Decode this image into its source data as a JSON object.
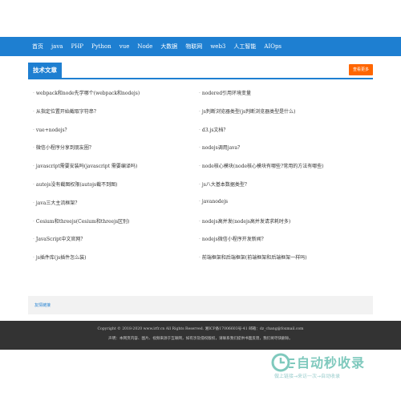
{
  "nav": {
    "items": [
      "首页",
      "java",
      "PHP",
      "Python",
      "vue",
      "Node",
      "大数据",
      "物联网",
      "web3",
      "人工智能",
      "AIOps"
    ]
  },
  "section": {
    "title": "技术文章",
    "more": "查看更多"
  },
  "articles": {
    "left": [
      "webpack和node先学哪个(webpack和nodejs)",
      "从指定位置开始截取字符串？",
      "vue+nodejs？",
      "微信小程序分享到朋友圈？",
      "javascript需要安装吗(javascript 需要编译吗)",
      "autojs没有截图权限(autojs截不到图)",
      "java三大主流框架？",
      "Cesium和threejs(Cesium和threejs区别)",
      "JavaScript中文官网？",
      "js插件库(js插件怎么装)"
    ],
    "right": [
      "nodered引用环境变量",
      "js判断浏览器类型(js判断浏览器类型是什么)",
      "d3.js文档？",
      "nodejs调用java？",
      "node核心模块(node核心模块有哪些?常用的方法有哪些)",
      "js八大基本数据类型？",
      "javanodejs",
      "nodejs高并发(nodejs高并发请求耗时多)",
      "nodejs微信小程序开发新闻？",
      "前端框架和后端框架(前端框架和后端框架一样吗)"
    ]
  },
  "links": {
    "label": "友情链接"
  },
  "footer": {
    "line1": "Copyright © 2018-2020 www.irfr.cn All Rights Reserved.  湘ICP备17006603号-41  邮箱：dz_chang@foxmail.com",
    "line2": "声明：本网页内容、图片、视频来源于互联网，如有涉及侵权版权，请联系我们提供书面反馈，我们将尽快删除。"
  },
  "watermark": {
    "title": "自动秒收录",
    "subtitle": "做上链接→来访一次→自动收录",
    "color": "#7fc9bd"
  },
  "colors": {
    "accent": "#1e7fd1",
    "more": "#ff6600",
    "footer": "#333333"
  }
}
